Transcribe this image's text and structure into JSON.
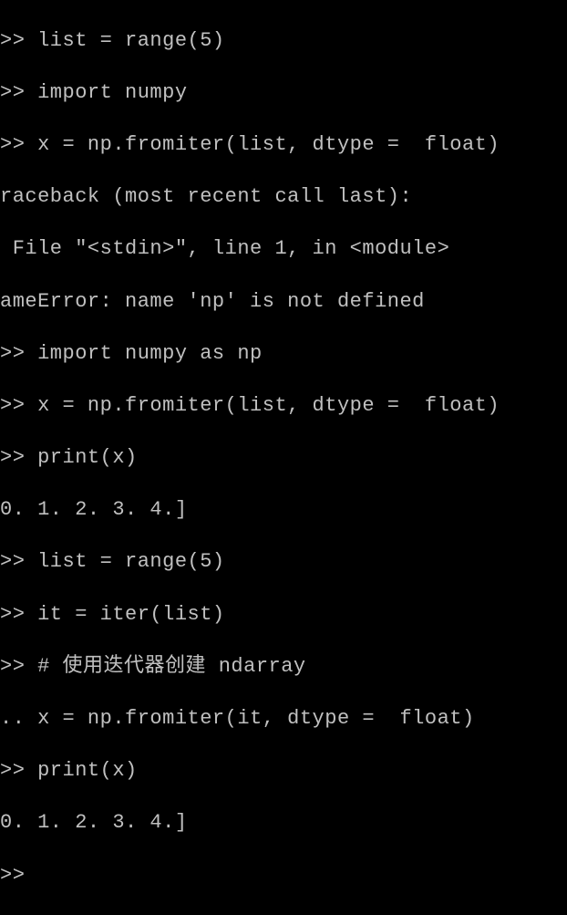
{
  "terminal": {
    "lines": [
      ">> list = range(5)",
      ">> import numpy",
      ">> x = np.fromiter(list, dtype =  float)",
      "raceback (most recent call last):",
      " File \"<stdin>\", line 1, in <module>",
      "ameError: name 'np' is not defined",
      ">> import numpy as np",
      ">> x = np.fromiter(list, dtype =  float)",
      ">> print(x)",
      "0. 1. 2. 3. 4.]",
      ">> list = range(5)",
      ">> it = iter(list)",
      ">> # 使用迭代器创建 ndarray",
      ".. x = np.fromiter(it, dtype =  float)",
      ">> print(x)",
      "0. 1. 2. 3. 4.]",
      ">>"
    ]
  }
}
